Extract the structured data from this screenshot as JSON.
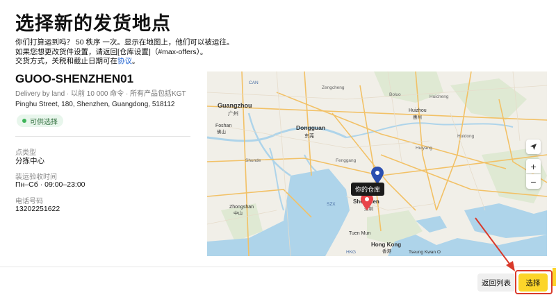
{
  "page": {
    "title": "选择新的发货地点",
    "intro_line1": "你们打算运到吗？ 50 秩序 一次。显示在地图上，他们可以被运往。",
    "intro_line2": "如果您想更改货件设置，请返回[仓库设置]（#max-offers）。",
    "intro_line3_prefix": "交货方式，关税和截止日期可在",
    "intro_line3_link": "协议",
    "intro_line3_suffix": "。"
  },
  "warehouse": {
    "name": "GUOO-SHENZHEN01",
    "subtitle": "Delivery by land · 以前 10 000 命令 · 所有产品包括KGT",
    "address": "Pinghu Street, 180, Shenzhen, Guangdong, 518112",
    "status": "可供选择",
    "point_type_label": "点类型",
    "point_type_value": "分拣中心",
    "hours_label": "装运验收时间",
    "hours_value": "Пн–Сб · 09:00–23:00",
    "phone_label": "电话号码",
    "phone_value": "13202251622"
  },
  "map": {
    "marker_label": "你的仓库",
    "zoom_in": "+",
    "zoom_out": "−",
    "locate_icon": "navigation-arrow-icon",
    "place_labels": {
      "guangzhou": "Guangzhou",
      "guangzhou_cn": "广州",
      "dongguan": "Dongguan",
      "dongguan_cn": "东莞",
      "shenzhen": "Shenzhen",
      "shenzhen_cn": "深圳",
      "huizhou": "Huizhou",
      "huizhou_cn": "惠州",
      "foshan": "Foshan",
      "foshan_cn": "佛山",
      "shunde": "Shunde",
      "zhongshan": "Zhongshan",
      "zhongshan_cn": "中山",
      "hong_kong": "Hong Kong",
      "hong_kong_cn": "香港",
      "tuen_mun": "Tuen Mun",
      "tseung_kwan_o": "Tseung Kwan O",
      "zengcheng": "Zengcheng",
      "boluo": "Boluo",
      "huiyang": "Huiyang",
      "huidong": "Huidong",
      "huicheng": "Huicheng",
      "fenggang": "Fenggang",
      "can": "CAN",
      "szx": "SZX",
      "hkg": "HKG"
    }
  },
  "footer": {
    "back_label": "返回列表",
    "select_label": "选择"
  },
  "colors": {
    "accent_yellow": "#fcd52a",
    "highlight_red": "#d93a2b",
    "marker_blue": "#2b4fb0",
    "marker_red": "#e8444a",
    "status_green": "#3fb55a"
  }
}
